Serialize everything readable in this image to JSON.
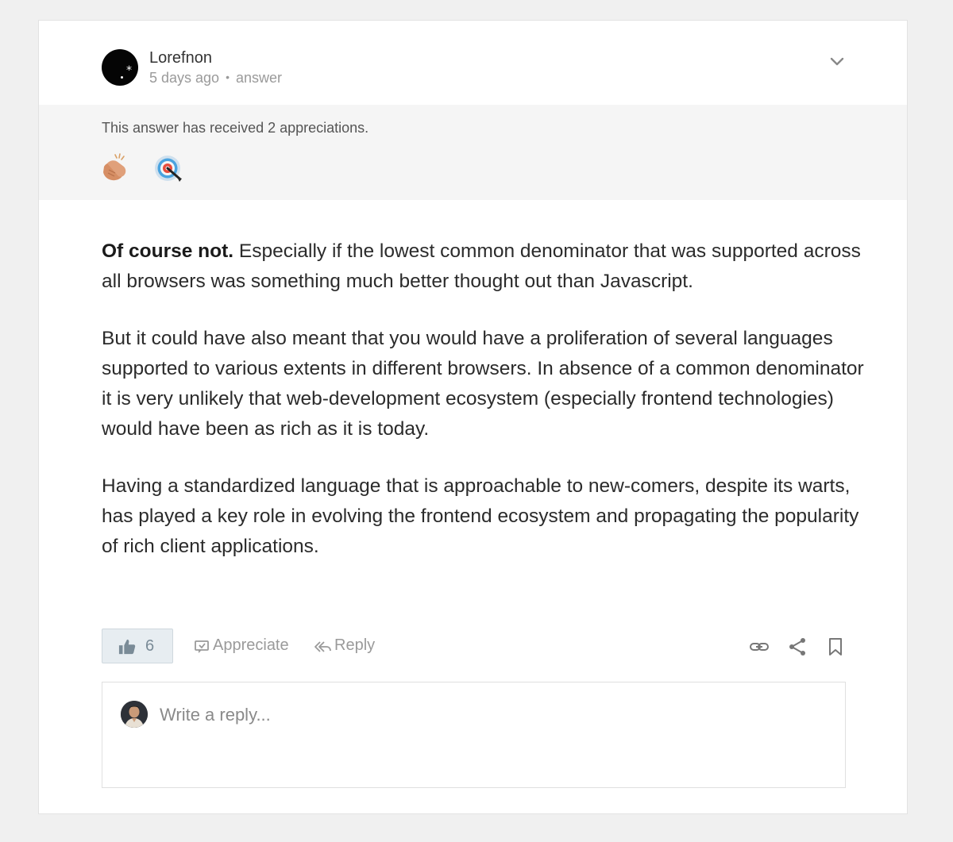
{
  "post": {
    "author": "Lorefnon",
    "time": "5 days ago",
    "separator": "•",
    "type": "answer"
  },
  "appreciations": {
    "text": "This answer has received 2 appreciations.",
    "icons": [
      "clapping-hands-icon",
      "target-icon"
    ]
  },
  "body": {
    "p1_bold": "Of course not.",
    "p1_rest": " Especially if the lowest common denominator that was supported across all browsers was something much better thought out than Javascript.",
    "p2": "But it could have also meant that you would have a proliferation of several languages supported to various extents in different browsers. In absence of a common denominator it is very unlikely that web-development ecosystem (especially frontend technologies) would have been as rich as it is today.",
    "p3": "Having a standardized language that is approachable to new-comers, despite its warts, has played a key role in evolving the frontend ecosystem and propagating the popularity of rich client applications."
  },
  "actions": {
    "upvote_count": "6",
    "appreciate_label": "Appreciate",
    "reply_label": "Reply"
  },
  "reply": {
    "placeholder": "Write a reply..."
  },
  "colors": {
    "page_bg": "#f0f0f0",
    "card_bg": "#ffffff",
    "appreciation_bg": "#f5f5f5",
    "upvote_bg": "#e7edf1",
    "muted_text": "#9a9a9a"
  }
}
